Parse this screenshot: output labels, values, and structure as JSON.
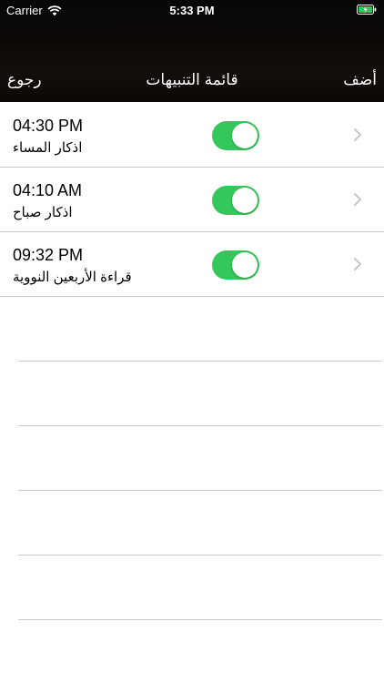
{
  "status_bar": {
    "carrier": "Carrier",
    "time": "5:33 PM"
  },
  "nav_bar": {
    "back_label": "رجوع",
    "title": "قائمة التنبيهات",
    "add_label": "أضف"
  },
  "alarms": [
    {
      "time": "04:30 PM",
      "name": "اذكار المساء",
      "enabled": true
    },
    {
      "time": "04:10 AM",
      "name": "اذكار صباح",
      "enabled": true
    },
    {
      "time": "09:32 PM",
      "name": "قراءة الأربعين النووية",
      "enabled": true
    }
  ],
  "colors": {
    "toggle_on": "#34c759",
    "separator": "#c8c8cc",
    "nav_text": "#ffffff"
  },
  "icons": {
    "wifi": "wifi-icon",
    "battery": "battery-charging-icon",
    "chevron": "chevron-right-icon"
  }
}
